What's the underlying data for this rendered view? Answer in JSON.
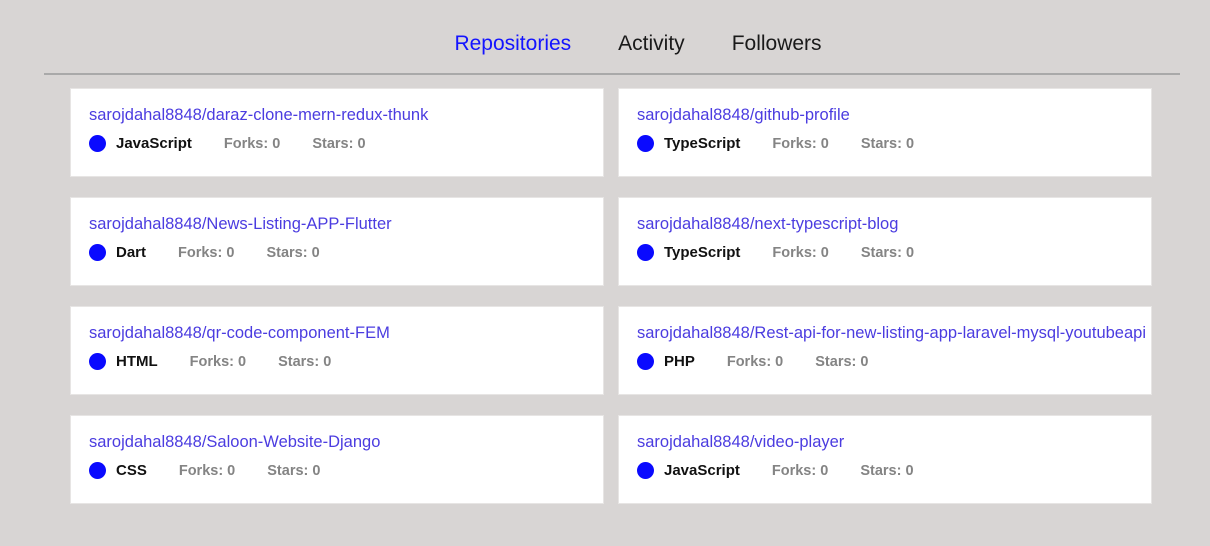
{
  "tabs": [
    {
      "label": "Repositories",
      "active": true
    },
    {
      "label": "Activity",
      "active": false
    },
    {
      "label": "Followers",
      "active": false
    }
  ],
  "labels": {
    "forks_prefix": "Forks:",
    "stars_prefix": "Stars:"
  },
  "colors": {
    "background": "#d8d5d4",
    "card_background": "#ffffff",
    "card_border": "#e7e5e4",
    "active_tab": "#1414ff",
    "inactive_tab": "#1a1a1a",
    "repo_link": "#4b3ce0",
    "language_dot": "#0a0aff",
    "stat_text": "#848484",
    "divider": "#a9a9a9"
  },
  "repositories": [
    {
      "name": "sarojdahal8848/daraz-clone-mern-redux-thunk",
      "language": "JavaScript",
      "forks": "0",
      "stars": "0",
      "forks_text": "Forks: 0",
      "stars_text": "Stars: 0"
    },
    {
      "name": "sarojdahal8848/github-profile",
      "language": "TypeScript",
      "forks": "0",
      "stars": "0",
      "forks_text": "Forks: 0",
      "stars_text": "Stars: 0"
    },
    {
      "name": "sarojdahal8848/News-Listing-APP-Flutter",
      "language": "Dart",
      "forks": "0",
      "stars": "0",
      "forks_text": "Forks: 0",
      "stars_text": "Stars: 0"
    },
    {
      "name": "sarojdahal8848/next-typescript-blog",
      "language": "TypeScript",
      "forks": "0",
      "stars": "0",
      "forks_text": "Forks: 0",
      "stars_text": "Stars: 0"
    },
    {
      "name": "sarojdahal8848/qr-code-component-FEM",
      "language": "HTML",
      "forks": "0",
      "stars": "0",
      "forks_text": "Forks: 0",
      "stars_text": "Stars: 0"
    },
    {
      "name": "sarojdahal8848/Rest-api-for-new-listing-app-laravel-mysql-youtubeapi",
      "language": "PHP",
      "forks": "0",
      "stars": "0",
      "forks_text": "Forks: 0",
      "stars_text": "Stars: 0"
    },
    {
      "name": "sarojdahal8848/Saloon-Website-Django",
      "language": "CSS",
      "forks": "0",
      "stars": "0",
      "forks_text": "Forks: 0",
      "stars_text": "Stars: 0"
    },
    {
      "name": "sarojdahal8848/video-player",
      "language": "JavaScript",
      "forks": "0",
      "stars": "0",
      "forks_text": "Forks: 0",
      "stars_text": "Stars: 0"
    }
  ]
}
